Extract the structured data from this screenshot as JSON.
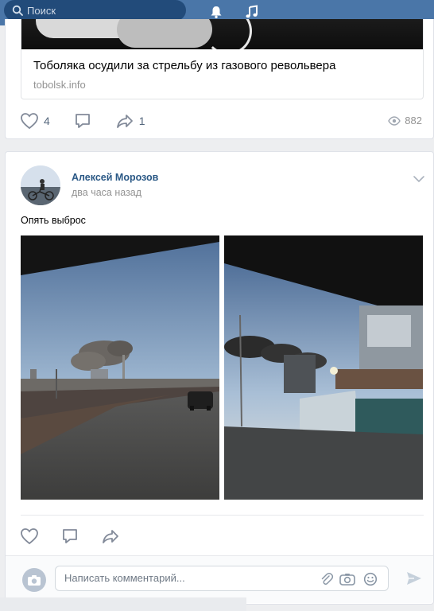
{
  "header": {
    "search_placeholder": "Поиск",
    "icons": [
      "search-icon",
      "bell-icon",
      "music-icon"
    ],
    "bar_color": "#4a76a8"
  },
  "post1": {
    "link_title": "Тоболяка осудили за стрельбу из газового револьвера",
    "link_domain": "tobolsk.info",
    "likes": "4",
    "reposts": "1",
    "views": "882"
  },
  "post2": {
    "author": "Алексей Морозов",
    "time": "два часа назад",
    "text": "Опять выброс",
    "comment_placeholder": "Написать комментарий..."
  },
  "colors": {
    "link": "#2a5885",
    "muted": "#939393",
    "icon": "#828a99"
  }
}
